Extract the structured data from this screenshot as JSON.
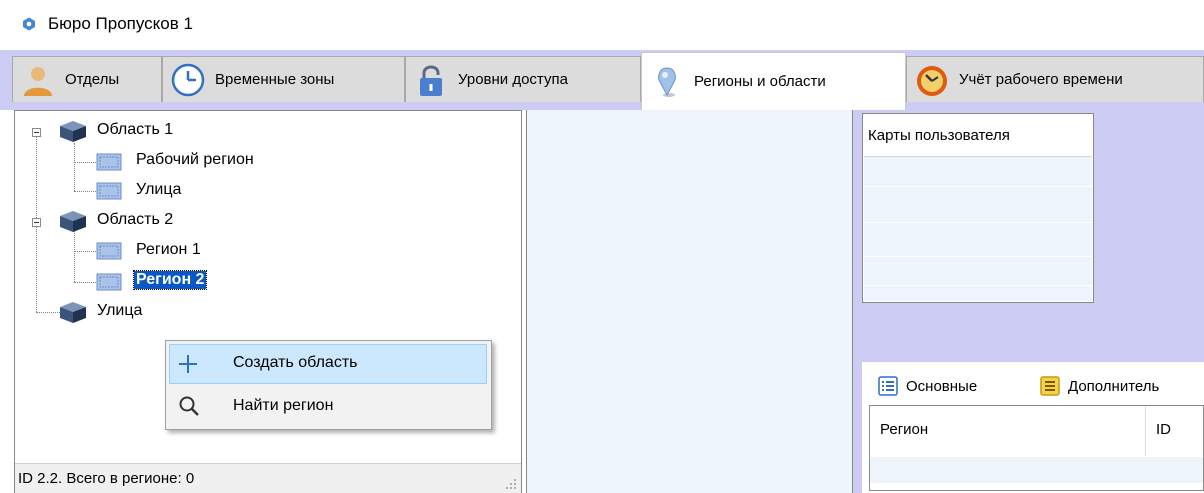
{
  "window": {
    "title": "Бюро Пропусков 1",
    "icon": "app-hexagon-icon"
  },
  "tabs": [
    {
      "label": "Отделы",
      "icon": "person-icon",
      "active": false
    },
    {
      "label": "Временные зоны",
      "icon": "clock-icon",
      "active": false
    },
    {
      "label": "Уровни доступа",
      "icon": "lock-icon",
      "active": false
    },
    {
      "label": "Регионы и области",
      "icon": "location-pin-icon",
      "active": true
    },
    {
      "label": "Учёт рабочего времени",
      "icon": "stopwatch-icon",
      "active": false
    }
  ],
  "tree": {
    "nodes": [
      {
        "label": "Область 1",
        "type": "area"
      },
      {
        "label": "Рабочий регион",
        "type": "region"
      },
      {
        "label": "Улица",
        "type": "region"
      },
      {
        "label": "Область 2",
        "type": "area"
      },
      {
        "label": "Регион 1",
        "type": "region"
      },
      {
        "label": "Регион 2",
        "type": "region",
        "selected": true
      },
      {
        "label": "Улица",
        "type": "area"
      }
    ]
  },
  "context_menu": {
    "items": [
      {
        "label": "Создать область",
        "icon": "plus-icon",
        "highlighted": true
      },
      {
        "label": "Найти регион",
        "icon": "search-icon"
      }
    ]
  },
  "status": {
    "text": "ID 2.2. Всего в регионе: 0"
  },
  "cards_panel": {
    "header": "Карты пользователя"
  },
  "lower_tabs": [
    {
      "label": "Основные",
      "icon": "list-blue-icon"
    },
    {
      "label": "Дополнитель",
      "icon": "list-yellow-icon"
    }
  ],
  "lower_grid": {
    "columns": [
      "Регион",
      "ID"
    ]
  },
  "colors": {
    "accent_bg": "#ccccf4",
    "selection": "#0a58c8",
    "menu_hover": "#cce8ff",
    "light_row": "#eef4fc"
  }
}
